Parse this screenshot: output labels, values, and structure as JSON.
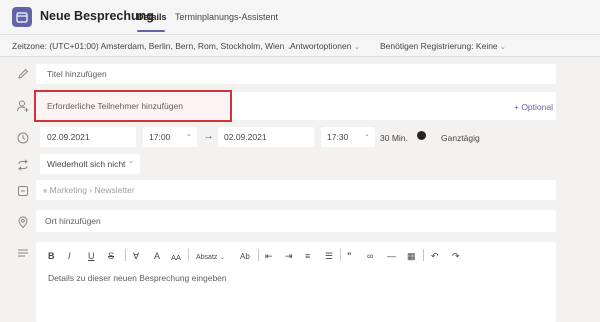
{
  "header": {
    "title": "Neue Besprechung",
    "tabs": [
      "Details",
      "Terminplanungs-Assistent"
    ]
  },
  "options": {
    "timezone": "Zeitzone: (UTC+01:00) Amsterdam, Berlin, Bern, Rom, Stockholm, Wien",
    "response": "Antwortoptionen",
    "registration": "Benötigen Registrierung: Keine"
  },
  "form": {
    "title_placeholder": "Titel hinzufügen",
    "attendees_placeholder": "Erforderliche Teilnehmer hinzufügen",
    "optional_link": "+ Optional",
    "start_date": "02.09.2021",
    "start_time": "17:00",
    "end_date": "02.09.2021",
    "end_time": "17:30",
    "duration": "30 Min.",
    "allday_label": "Ganztägig",
    "repeat": "Wiederholt sich nicht",
    "channel_team": "Marketing",
    "channel_name": "Newsletter",
    "location_placeholder": "Ort hinzufügen",
    "details_placeholder": "Details zu dieser neuen Besprechung eingeben"
  },
  "toolbar": {
    "bold": "B",
    "italic": "I",
    "underline": "U",
    "strike": "S",
    "highlight": "∀",
    "font_size_a": "A",
    "font_size_aa": "AA",
    "paragraph": "Absatz",
    "format_marker": "Ab"
  },
  "colors": {
    "accent": "#6264a7",
    "highlight_border": "#d13438"
  }
}
